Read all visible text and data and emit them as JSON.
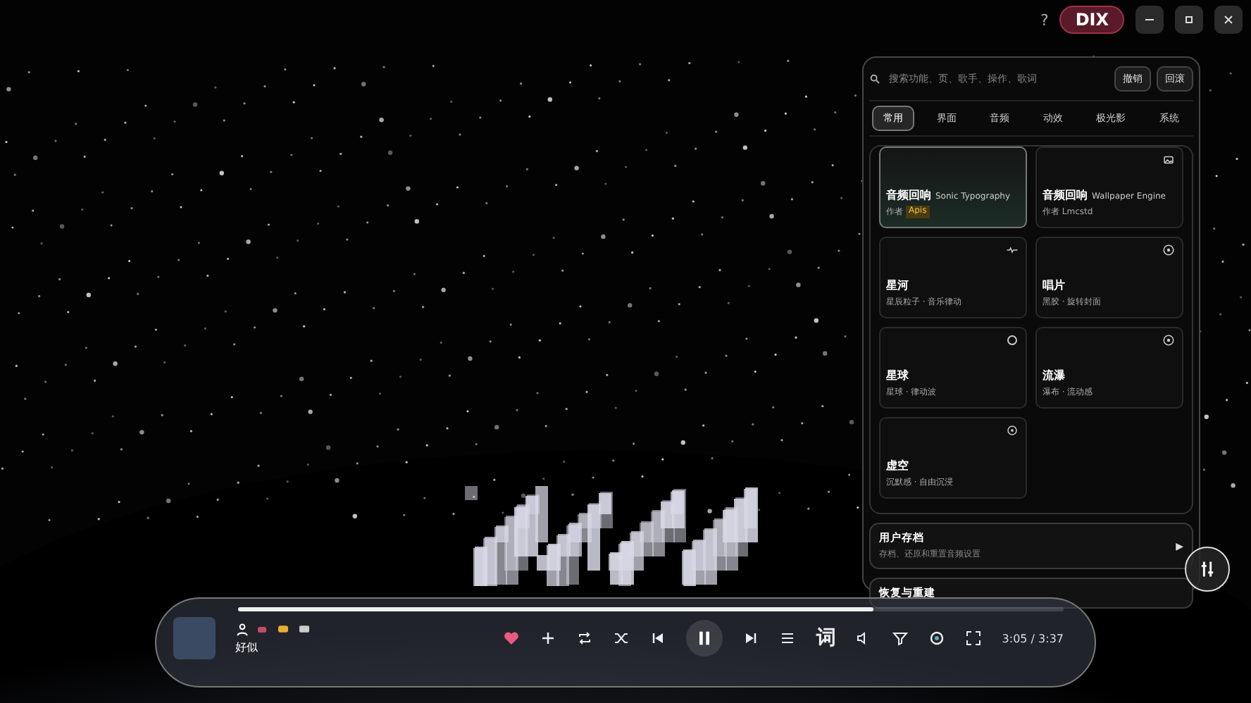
{
  "titlebar": {
    "help": "?",
    "badge": "DIX"
  },
  "panel": {
    "search": {
      "placeholder": "搜索功能、页、歌手、操作、歌词"
    },
    "actions": [
      "撤销",
      "回滚"
    ],
    "tabs": [
      {
        "label": "常用",
        "selected": true
      },
      {
        "label": "界面",
        "selected": false
      },
      {
        "label": "音频",
        "selected": false
      },
      {
        "label": "动效",
        "selected": false
      },
      {
        "label": "极光影",
        "selected": false
      },
      {
        "label": "系统",
        "selected": false
      }
    ],
    "cards": [
      {
        "title": "音频回响",
        "subtitle": "Sonic Typography",
        "meta": "作者",
        "author": "Apis",
        "selected": true,
        "kind": "plain"
      },
      {
        "title": "音频回响",
        "subtitle": "Wallpaper Engine",
        "meta": "作者 Lmcstd",
        "selected": false,
        "kind": "image"
      },
      {
        "title": "星河",
        "meta": "星辰粒子 · 音乐律动",
        "selected": false,
        "kind": "wave"
      },
      {
        "title": "唱片",
        "meta": "黑胶 · 旋转封面",
        "selected": false,
        "kind": "disc"
      },
      {
        "title": "星球",
        "meta": "星球 · 律动波",
        "selected": false,
        "kind": "ring"
      },
      {
        "title": "流瀑",
        "meta": "瀑布 · 流动感",
        "selected": false,
        "kind": "disc"
      },
      {
        "title": "虚空",
        "meta": "沉默感 · 自由沉浸",
        "selected": false,
        "kind": "target"
      }
    ],
    "sections": [
      {
        "title": "用户存档",
        "desc": "存档、还原和重置音频设置",
        "arrow": "▶"
      },
      {
        "title": "恢复与重建"
      }
    ]
  },
  "player": {
    "title": "好似",
    "progress": {
      "level": 0.77
    },
    "lyrics": "词",
    "time": "3:05 / 3:37"
  }
}
